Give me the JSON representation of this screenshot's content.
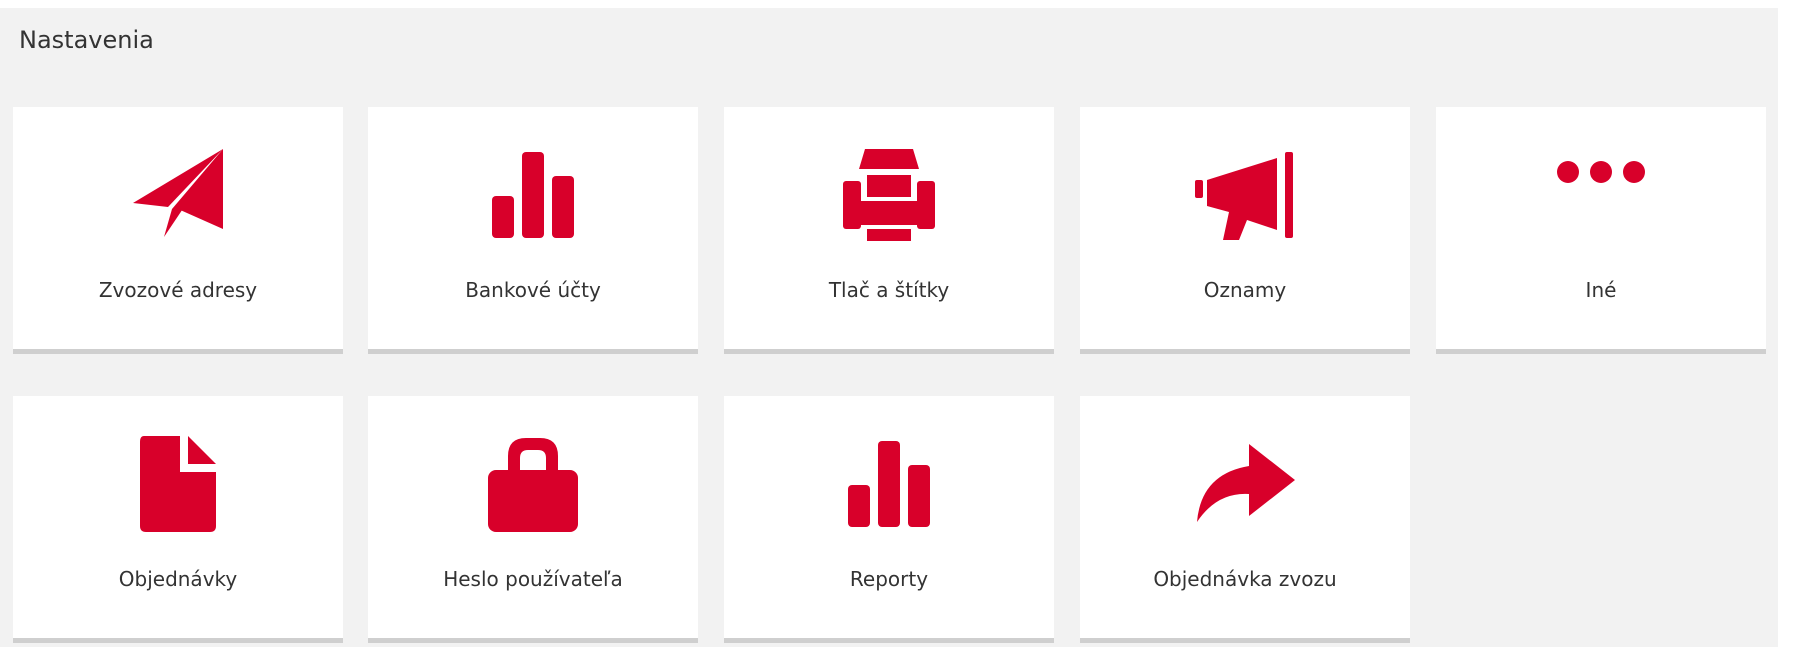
{
  "page": {
    "title": "Nastavenia"
  },
  "colors": {
    "accent": "#d8002a",
    "panel_bg": "#f2f2f2",
    "tile_bg": "#ffffff",
    "tile_border": "#cfcfcf",
    "text": "#333333"
  },
  "tiles": [
    {
      "label": "Zvozové adresy",
      "icon": "paper-plane-icon"
    },
    {
      "label": "Bankové účty",
      "icon": "bar-chart-icon"
    },
    {
      "label": "Tlač a štítky",
      "icon": "printer-icon"
    },
    {
      "label": "Oznamy",
      "icon": "megaphone-icon"
    },
    {
      "label": "Iné",
      "icon": "more-dots-icon"
    },
    {
      "label": "Objednávky",
      "icon": "document-icon"
    },
    {
      "label": "Heslo používateľa",
      "icon": "lock-icon"
    },
    {
      "label": "Reporty",
      "icon": "bar-chart-icon"
    },
    {
      "label": "Objednávka zvozu",
      "icon": "share-arrow-icon"
    }
  ]
}
